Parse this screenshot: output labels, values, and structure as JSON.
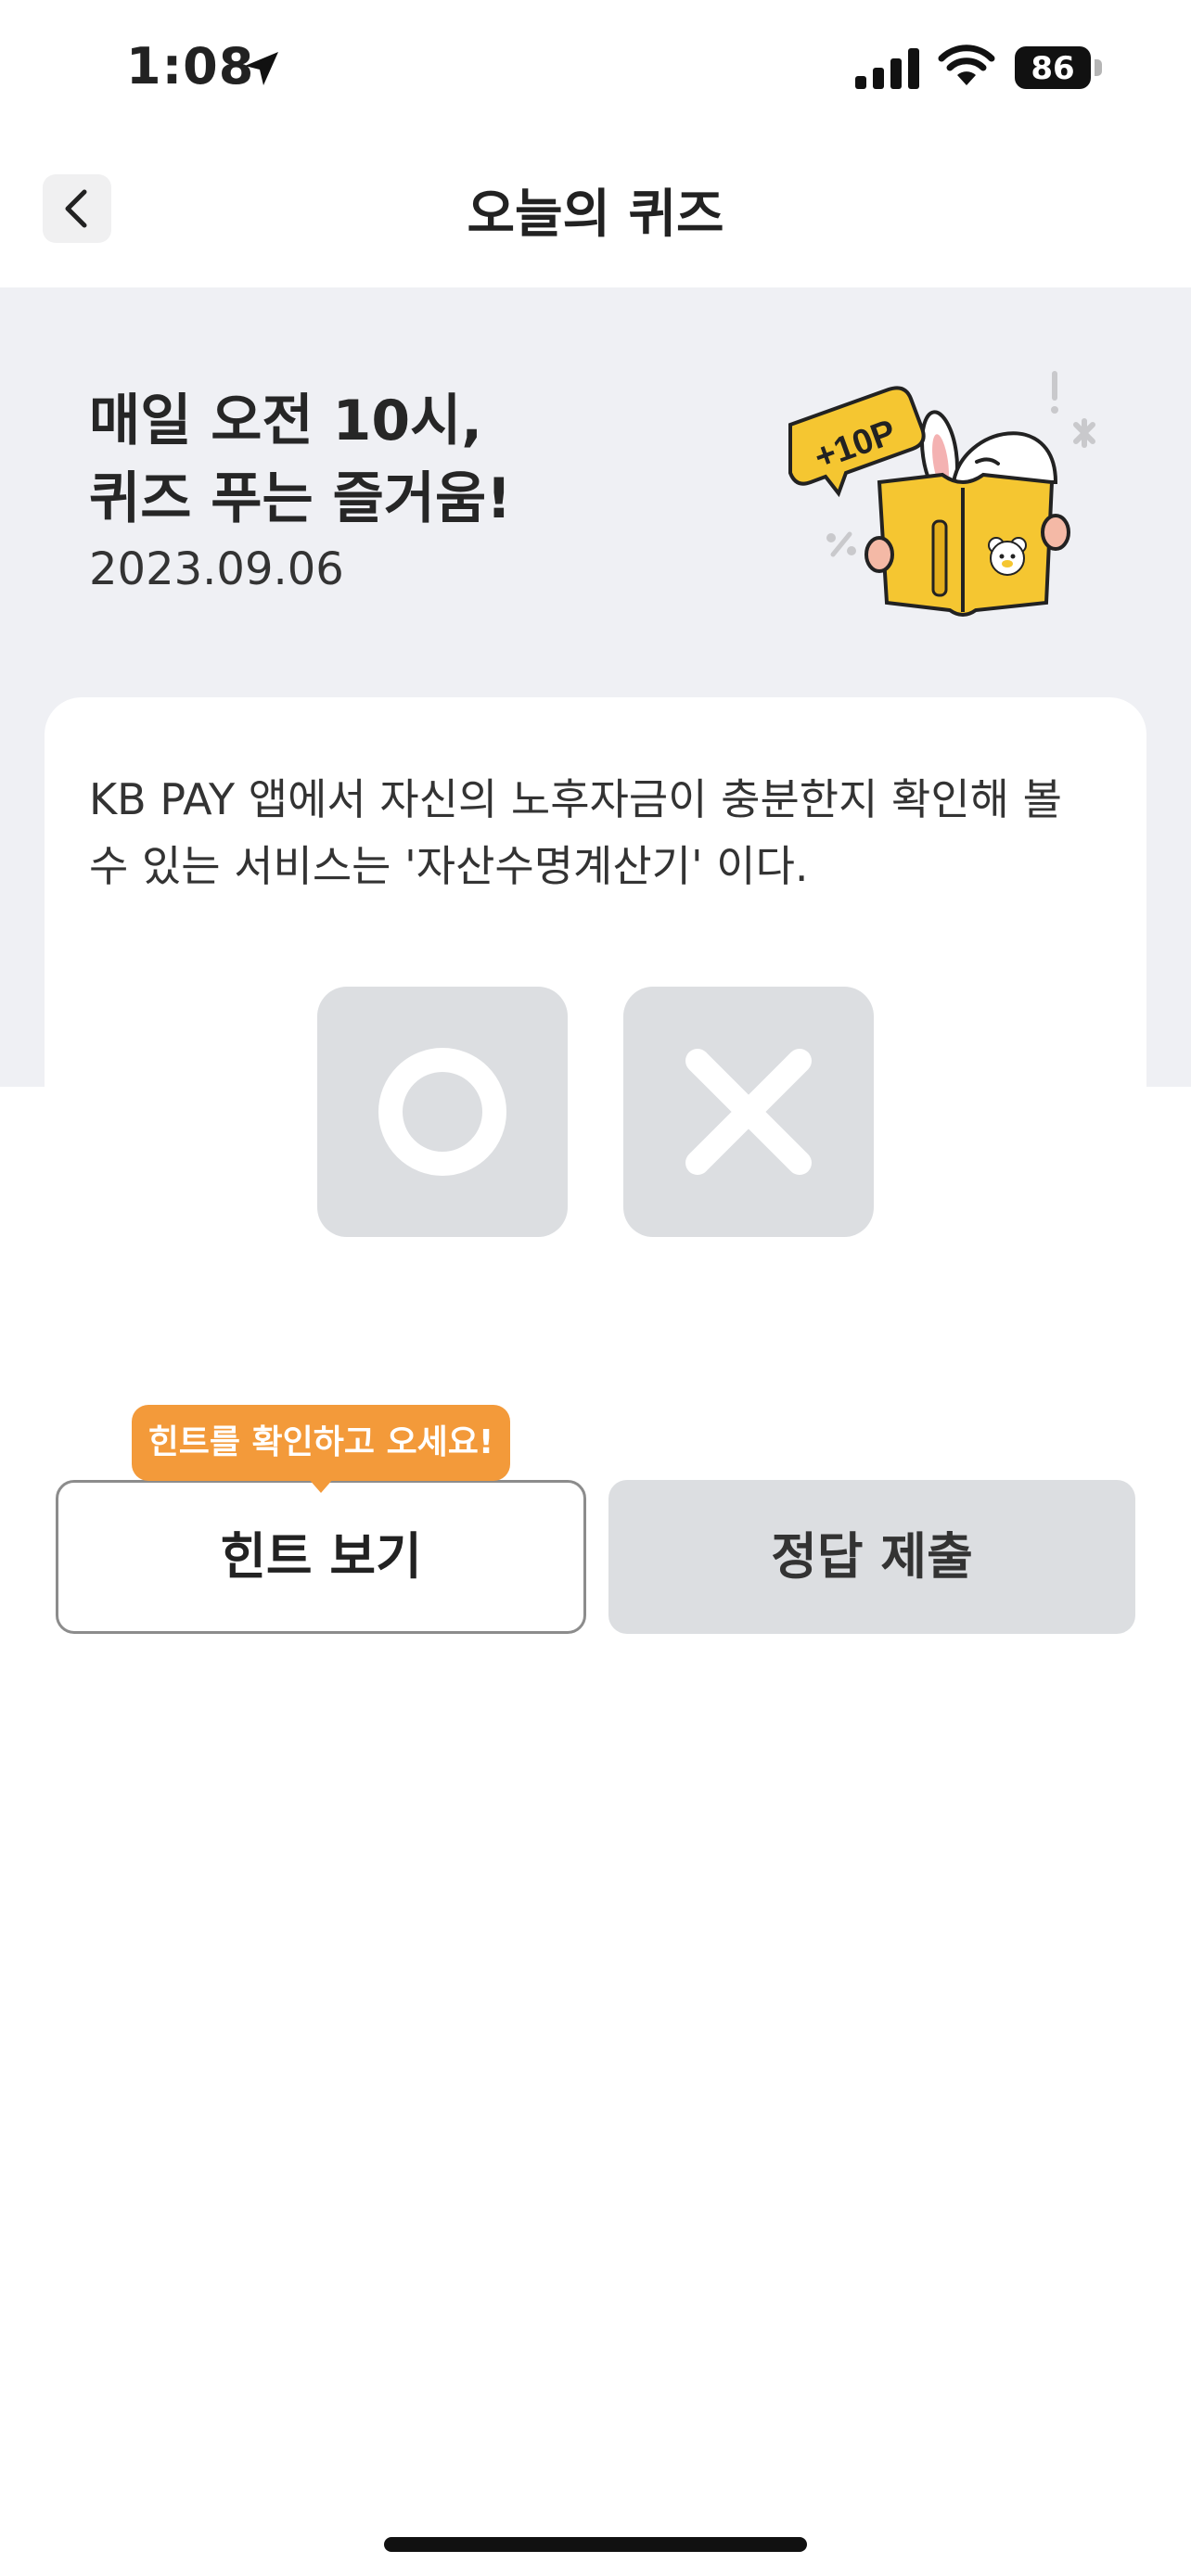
{
  "status_bar": {
    "time": "1:08",
    "battery": "86"
  },
  "nav": {
    "title": "오늘의 퀴즈"
  },
  "hero": {
    "title_line1": "매일 오전 10시,",
    "title_line2": "퀴즈 푸는 즐거움!",
    "date": "2023.09.06",
    "badge": "+10P"
  },
  "quiz": {
    "question": "KB PAY 앱에서 자신의 노후자금이 충분한지 확인해 볼 수 있는 서비스는 '자산수명계산기' 이다."
  },
  "tooltip": {
    "text": "힌트를 확인하고 오세요!"
  },
  "buttons": {
    "hint": "힌트 보기",
    "submit": "정답 제출"
  },
  "colors": {
    "hero_bg": "#eff0f4",
    "answer_bg": "#dcdee1",
    "tooltip": "#f39a3a",
    "book_yellow": "#f5c631"
  }
}
